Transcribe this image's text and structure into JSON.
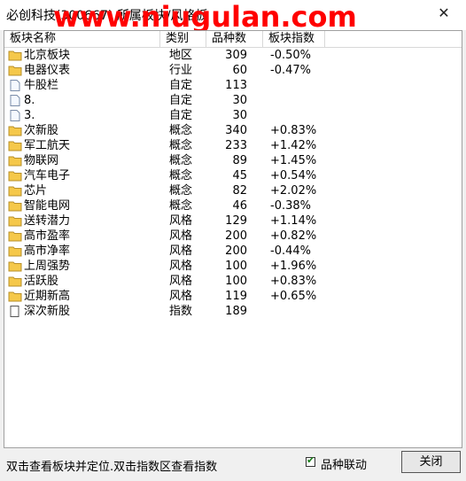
{
  "window": {
    "title": "必创科技(300667) 所属板块/风格板",
    "watermark": "www.niugulan.com",
    "close_glyph": "✕"
  },
  "table": {
    "headers": [
      "板块名称",
      "类别",
      "品种数",
      "板块指数"
    ],
    "rows": [
      {
        "icon": "folder",
        "name": "北京板块",
        "type": "地区",
        "count": "309",
        "pct": "-0.50%"
      },
      {
        "icon": "folder",
        "name": "电器仪表",
        "type": "行业",
        "count": "60",
        "pct": "-0.47%"
      },
      {
        "icon": "doc",
        "name": "牛股栏",
        "type": "自定",
        "count": "113",
        "pct": ""
      },
      {
        "icon": "doc",
        "name": "8.",
        "type": "自定",
        "count": "30",
        "pct": ""
      },
      {
        "icon": "doc",
        "name": "3.",
        "type": "自定",
        "count": "30",
        "pct": ""
      },
      {
        "icon": "folder",
        "name": "次新股",
        "type": "概念",
        "count": "340",
        "pct": "+0.83%"
      },
      {
        "icon": "folder",
        "name": "军工航天",
        "type": "概念",
        "count": "233",
        "pct": "+1.42%"
      },
      {
        "icon": "folder",
        "name": "物联网",
        "type": "概念",
        "count": "89",
        "pct": "+1.45%"
      },
      {
        "icon": "folder",
        "name": "汽车电子",
        "type": "概念",
        "count": "45",
        "pct": "+0.54%"
      },
      {
        "icon": "folder",
        "name": "芯片",
        "type": "概念",
        "count": "82",
        "pct": "+2.02%"
      },
      {
        "icon": "folder",
        "name": "智能电网",
        "type": "概念",
        "count": "46",
        "pct": "-0.38%"
      },
      {
        "icon": "folder",
        "name": "送转潜力",
        "type": "风格",
        "count": "129",
        "pct": "+1.14%"
      },
      {
        "icon": "folder",
        "name": "高市盈率",
        "type": "风格",
        "count": "200",
        "pct": "+0.82%"
      },
      {
        "icon": "folder",
        "name": "高市净率",
        "type": "风格",
        "count": "200",
        "pct": "-0.44%"
      },
      {
        "icon": "folder",
        "name": "上周强势",
        "type": "风格",
        "count": "100",
        "pct": "+1.96%"
      },
      {
        "icon": "folder",
        "name": "活跃股",
        "type": "风格",
        "count": "100",
        "pct": "+0.83%"
      },
      {
        "icon": "folder",
        "name": "近期新高",
        "type": "风格",
        "count": "119",
        "pct": "+0.65%"
      },
      {
        "icon": "blank",
        "name": "深次新股",
        "type": "指数",
        "count": "189",
        "pct": ""
      }
    ]
  },
  "status": {
    "hint": "双击查看板块并定位.双击指数区查看指数",
    "checkbox_label": "品种联动",
    "checkbox_checked": true,
    "check_glyph": "✔",
    "close_label": "关闭"
  },
  "colors": {
    "folder_fill": "#f5c84a",
    "folder_stroke": "#b8902a",
    "watermark": "#ff0000"
  }
}
